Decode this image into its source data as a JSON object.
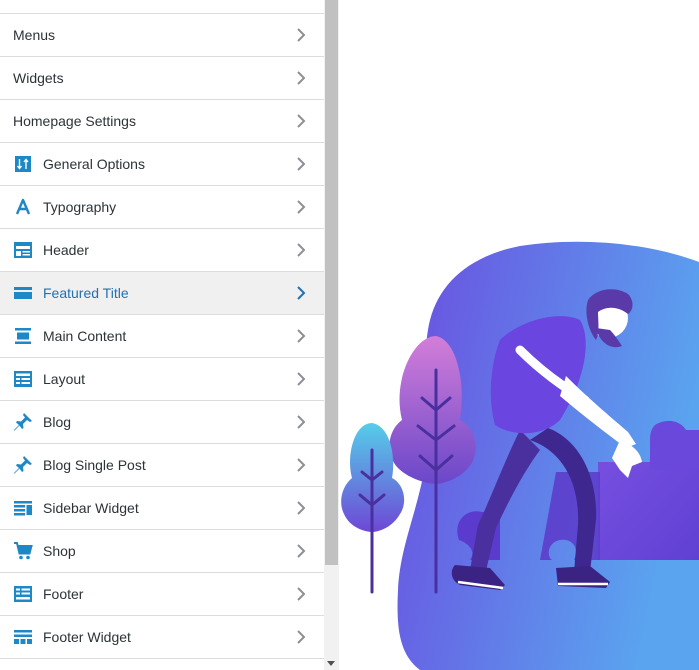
{
  "panel": {
    "items": [
      {
        "label": "Menus",
        "icon": "none"
      },
      {
        "label": "Widgets",
        "icon": "none"
      },
      {
        "label": "Homepage Settings",
        "icon": "none"
      },
      {
        "label": "General Options",
        "icon": "sort-arrows-icon"
      },
      {
        "label": "Typography",
        "icon": "typography-icon"
      },
      {
        "label": "Header",
        "icon": "header-icon"
      },
      {
        "label": "Featured Title",
        "icon": "featured-title-icon",
        "active": true
      },
      {
        "label": "Main Content",
        "icon": "main-content-icon"
      },
      {
        "label": "Layout",
        "icon": "layout-icon"
      },
      {
        "label": "Blog",
        "icon": "pin-icon"
      },
      {
        "label": "Blog Single Post",
        "icon": "pin-icon"
      },
      {
        "label": "Sidebar Widget",
        "icon": "sidebar-widget-icon"
      },
      {
        "label": "Shop",
        "icon": "cart-icon"
      },
      {
        "label": "Footer",
        "icon": "footer-icon"
      },
      {
        "label": "Footer Widget",
        "icon": "footer-widget-icon"
      }
    ]
  },
  "colors": {
    "accent": "#2271b1",
    "icon": "#1e88c7",
    "text": "#2c3338",
    "border": "#dcdcde",
    "active_bg": "#f0f0f1",
    "illustration_purple": "#6b4de0",
    "illustration_blue": "#5aa0f0"
  },
  "preview": {
    "illustration": "person-with-puzzle-pieces-and-plants"
  }
}
